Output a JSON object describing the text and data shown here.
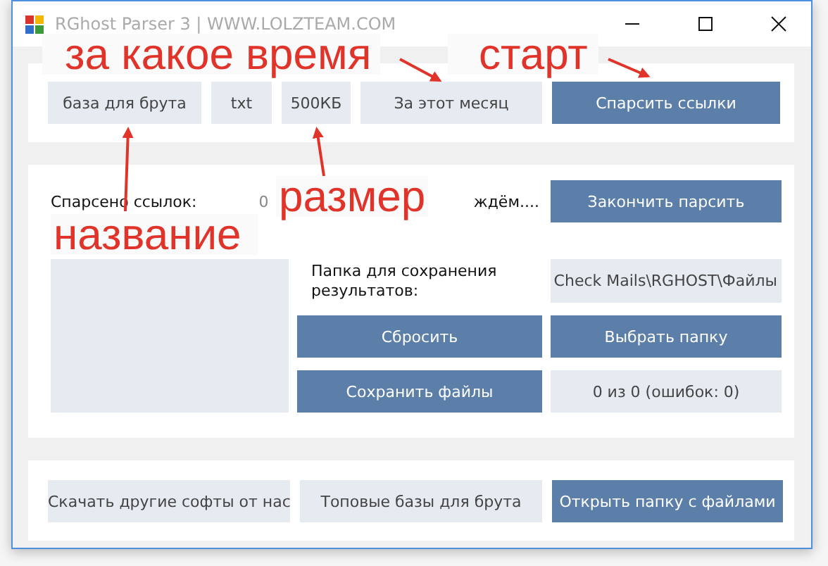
{
  "window": {
    "title": "RGhost Parser 3 | WWW.LOLZTEAM.COM"
  },
  "top_panel": {
    "fields": [
      {
        "value": "база для брута"
      },
      {
        "value": "txt"
      },
      {
        "value": "500КБ"
      },
      {
        "value": "За этот месяц"
      }
    ],
    "start_button": "Спарсить ссылки"
  },
  "middle_panel": {
    "parsed_label": "Спарсено ссылок:",
    "parsed_count": "0",
    "status": "ждём....",
    "stop_button": "Закончить парсить",
    "folder_label": "Папка для сохранения результатов:",
    "folder_path": "Check Mails\\RGHOST\\Файлы",
    "reset_button": "Сбросить",
    "choose_folder_button": "Выбрать папку",
    "save_button": "Сохранить файлы",
    "progress": "0 из 0 (ошибок: 0)"
  },
  "bottom_panel": {
    "buttons": [
      {
        "label": "Скачать другие софты от нас",
        "primary": false
      },
      {
        "label": "Топовые базы для брута",
        "primary": false
      },
      {
        "label": "Открыть папку с файлами",
        "primary": true
      }
    ]
  },
  "annotations": [
    {
      "text": "за какое время"
    },
    {
      "text": "старт"
    },
    {
      "text": "название"
    },
    {
      "text": "размер"
    }
  ]
}
